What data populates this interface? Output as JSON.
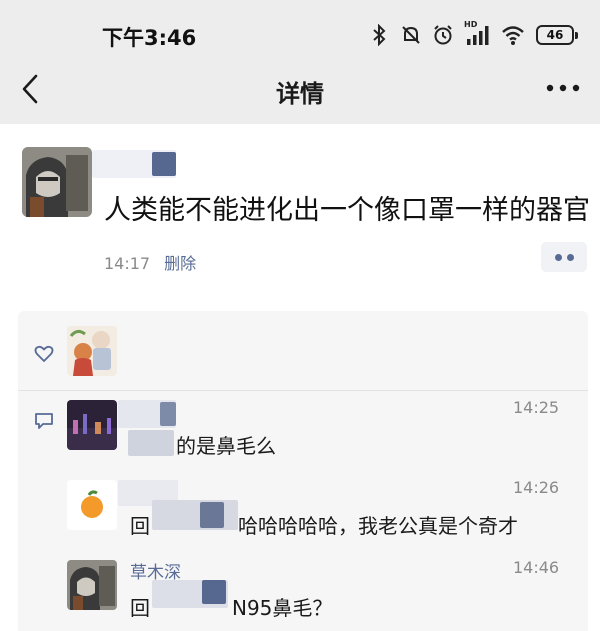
{
  "status_bar": {
    "time": "下午3:46",
    "signal_label": "HD",
    "battery": "46",
    "icons": [
      "bluetooth-icon",
      "mute-icon",
      "alarm-icon",
      "cell-signal-icon",
      "wifi-icon",
      "battery-icon"
    ]
  },
  "nav": {
    "title": "详情",
    "back_icon": "chevron-left-icon",
    "more_icon": "more-icon"
  },
  "post": {
    "text": "人类能不能进化出一个像口罩一样的器官",
    "time": "14:17",
    "delete_label": "删除"
  },
  "comments": [
    {
      "time": "14:25",
      "text": "的是鼻毛么"
    },
    {
      "time": "14:26",
      "prefix": "回",
      "text": "哈哈哈哈哈，我老公真是个奇才"
    },
    {
      "author": "草木深",
      "time": "14:46",
      "prefix": "回",
      "text": "N95鼻毛？"
    }
  ],
  "colors": {
    "link": "#576b95",
    "meta": "#8a8a8a",
    "panel": "#f6f6f6",
    "bar": "#ededed"
  }
}
